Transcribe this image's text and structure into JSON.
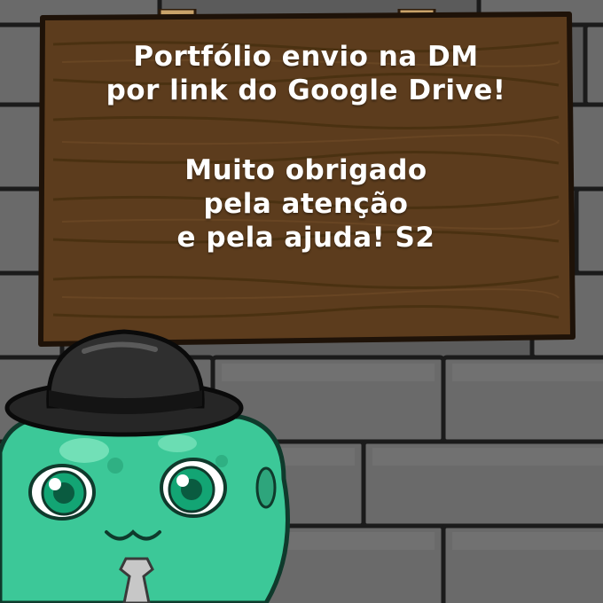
{
  "sign": {
    "line1": "Portfólio envio na DM",
    "line2": "por link do Google Drive!",
    "line3": "Muito obrigado",
    "line4": "pela atenção",
    "line5": "e pela ajuda! S2"
  },
  "colors": {
    "wall_base": "#5e5e5e",
    "brick_light": "#6f6f6f",
    "brick_dark": "#4a4a4a",
    "wood": "#5a3b1c",
    "wood_dark": "#3d2610",
    "text": "#ffffff",
    "slime_green": "#3fc79a",
    "slime_dark": "#1f8f68",
    "hat": "#2a2a2a",
    "tie": "#bdbdbd"
  }
}
